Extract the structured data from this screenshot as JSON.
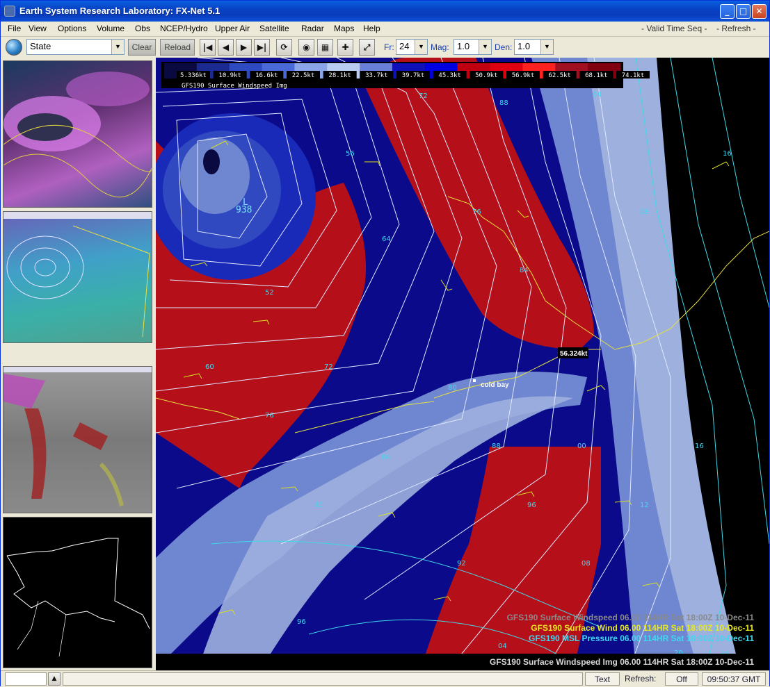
{
  "window": {
    "title": "Earth System Research Laboratory: FX-Net 5.1"
  },
  "menu": {
    "items": [
      "File",
      "View",
      "Options",
      "Volume",
      "Obs",
      "NCEP/Hydro",
      "Upper Air",
      "Satellite",
      "Radar",
      "Maps",
      "Help"
    ],
    "valid_time_seq": "- Valid Time Seq -",
    "refresh": "- Refresh -"
  },
  "toolbar": {
    "scale_value": "State",
    "clear_label": "Clear",
    "reload_label": "Reload",
    "fr_label": "Fr:",
    "fr_value": "24",
    "mag_label": "Mag:",
    "mag_value": "1.0",
    "den_label": "Den:",
    "den_value": "1.0"
  },
  "legend": {
    "ticks": [
      "5.336kt",
      "10.9kt",
      "16.6kt",
      "22.5kt",
      "28.1kt",
      "33.7kt",
      "39.7kt",
      "45.3kt",
      "50.9kt",
      "56.9kt",
      "62.5kt",
      "68.1kt",
      "74.1kt"
    ],
    "product": "GFS190 Surface Windspeed Img",
    "colors": [
      "#0a0a40",
      "#1a2a90",
      "#2e4ac0",
      "#4a6ad8",
      "#8aa6e8",
      "#b8cdf0",
      "#6a80d8",
      "#1010b8",
      "#0000e0",
      "#c00010",
      "#e00010",
      "#ff2020",
      "#a01020",
      "#800010"
    ]
  },
  "map": {
    "low_letter": "L",
    "low_value": "938",
    "sample_value": "56.324kt",
    "station": "cold bay",
    "isobar_labels": [
      "72",
      "88",
      "04",
      "16",
      "56",
      "76",
      "08",
      "64",
      "84",
      "52",
      "60",
      "72",
      "80",
      "76",
      "88",
      "00",
      "16",
      "84",
      "96",
      "12",
      "80",
      "92",
      "08",
      "96",
      "04",
      "20",
      "56"
    ],
    "colors": {
      "red": "#b5101a",
      "dark_red": "#7a0a12",
      "navy": "#0a0a8a",
      "blue": "#1a2ab8",
      "mid_blue": "#3048c0",
      "light_blue": "#6f86d0",
      "pale_blue": "#9db0de",
      "isobar": "#e0e8ff",
      "cyan": "#40d8e8",
      "wind": "#d8e020",
      "coast": "#e6e040"
    },
    "products": [
      {
        "text": "GFS190 Surface Windspeed  06.00 114HR Sat 18:00Z 10-Dec-11",
        "color": "#8a8a8a"
      },
      {
        "text": "GFS190 Surface Wind  06.00 114HR Sat 18:00Z 10-Dec-11",
        "color": "#e8e820"
      },
      {
        "text": "GFS190 MSL Pressure  06.00 114HR Sat 18:00Z 10-Dec-11",
        "color": "#40d8f0"
      }
    ],
    "bottom_caption": "GFS190 Surface Windspeed Img 06.00 114HR Sat 18:00Z 10-Dec-11"
  },
  "status": {
    "text_button": "Text",
    "refresh_label": "Refresh:",
    "refresh_value": "Off",
    "clock": "09:50:37 GMT"
  }
}
